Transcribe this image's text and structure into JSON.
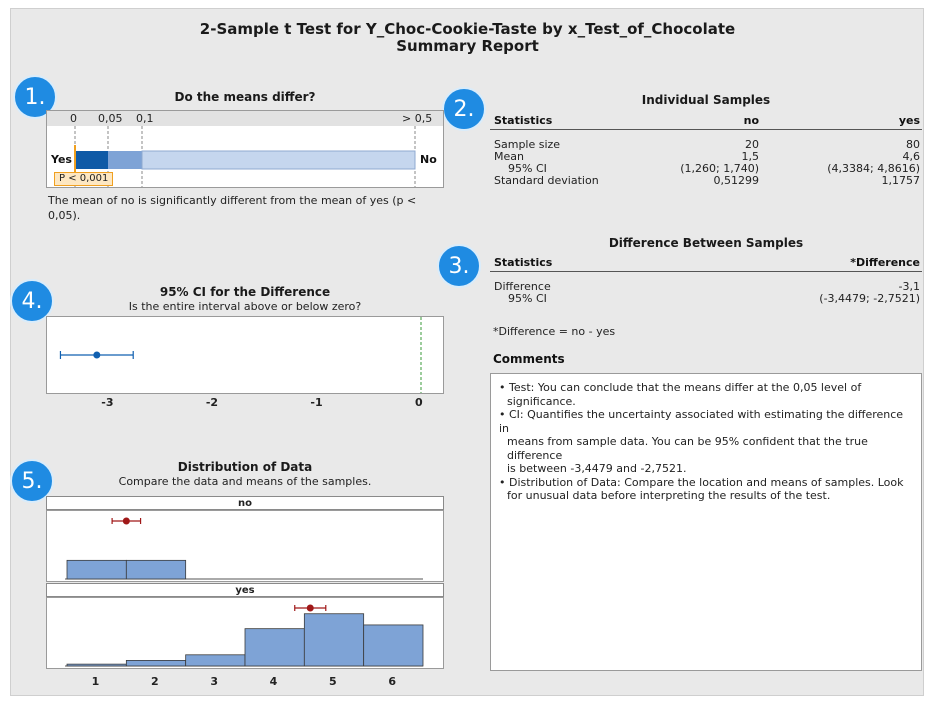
{
  "report": {
    "title_line1": "2-Sample t Test for Y_Choc-Cookie-Taste by x_Test_of_Chocolate",
    "title_line2": "Summary Report"
  },
  "colors": {
    "badge": "#1f8be2",
    "bar_dark": "#0f5aa6",
    "bar_mid": "#7ea3d6",
    "bar_light": "#c5d6ee",
    "marker_orange": "#f0a020",
    "point_blue": "#1060b0",
    "point_red": "#a01818",
    "hist_fill": "#7ea3d6",
    "zero_line": "#3a9a3a"
  },
  "badges": [
    "1.",
    "2.",
    "3.",
    "4.",
    "5."
  ],
  "section1": {
    "title": "Do the means differ?",
    "scale_labels": [
      "0",
      "0,05",
      "0,1",
      "> 0,5"
    ],
    "left_label": "Yes",
    "right_label": "No",
    "p_label": "P < 0,001",
    "conclusion": "The mean of no is significantly different from the mean of yes (p < 0,05)."
  },
  "section2": {
    "title": "Individual Samples",
    "headers": [
      "Statistics",
      "no",
      "yes"
    ],
    "rows": [
      [
        "Sample size",
        "20",
        "80"
      ],
      [
        "Mean",
        "1,5",
        "4,6"
      ],
      [
        "95% CI",
        "(1,260; 1,740)",
        "(4,3384; 4,8616)"
      ],
      [
        "Standard deviation",
        "0,51299",
        "1,1757"
      ]
    ]
  },
  "section3": {
    "title": "Difference Between Samples",
    "headers": [
      "Statistics",
      "*Difference"
    ],
    "rows": [
      [
        "Difference",
        "-3,1"
      ],
      [
        "95% CI",
        "(-3,4479; -2,7521)"
      ]
    ],
    "footnote": "*Difference = no - yes"
  },
  "comments": {
    "title": "Comments",
    "lines": [
      "• Test: You can conclude that the means differ at the 0,05 level of",
      "significance.",
      "• CI: Quantifies the uncertainty associated with estimating the difference in",
      "means from sample data. You can be 95% confident that the true difference",
      "is between -3,4479 and -2,7521.",
      "• Distribution of Data: Compare the location and means of samples. Look",
      "for unusual data before interpreting the results of the test."
    ]
  },
  "section4": {
    "title": "95% CI for the Difference",
    "subtitle": "Is the entire interval above or below zero?",
    "tick_labels": [
      "-3",
      "-2",
      "-1",
      "0"
    ]
  },
  "section5": {
    "title": "Distribution of Data",
    "subtitle": "Compare the data and means of the samples.",
    "facet_no": "no",
    "facet_yes": "yes",
    "tick_labels": [
      "1",
      "2",
      "3",
      "4",
      "5",
      "6"
    ]
  },
  "chart_data": [
    {
      "type": "bar",
      "title": "Do the means differ?",
      "p_value": "< 0,001",
      "scale": [
        "0",
        "0,05",
        "0,1",
        "> 0,5"
      ],
      "xlim": [
        0,
        0.5
      ]
    },
    {
      "type": "scatter",
      "title": "95% CI for the Difference",
      "estimate": -3.1,
      "ci": [
        -3.4479,
        -2.7521
      ],
      "xlim": [
        -3.5,
        0
      ],
      "reference_line": 0
    },
    {
      "type": "bar",
      "title": "Distribution of Data",
      "facets": [
        {
          "name": "no",
          "bins": [
            1,
            2,
            3,
            4,
            5,
            6
          ],
          "counts": [
            10,
            10,
            0,
            0,
            0,
            0
          ],
          "mean": 1.5,
          "ci": [
            1.26,
            1.74
          ]
        },
        {
          "name": "yes",
          "bins": [
            1,
            2,
            3,
            4,
            5,
            6
          ],
          "counts": [
            1,
            3,
            6,
            20,
            28,
            22
          ],
          "mean": 4.6,
          "ci": [
            4.3384,
            4.8616
          ]
        }
      ],
      "xlim": [
        0.5,
        6.5
      ]
    }
  ]
}
